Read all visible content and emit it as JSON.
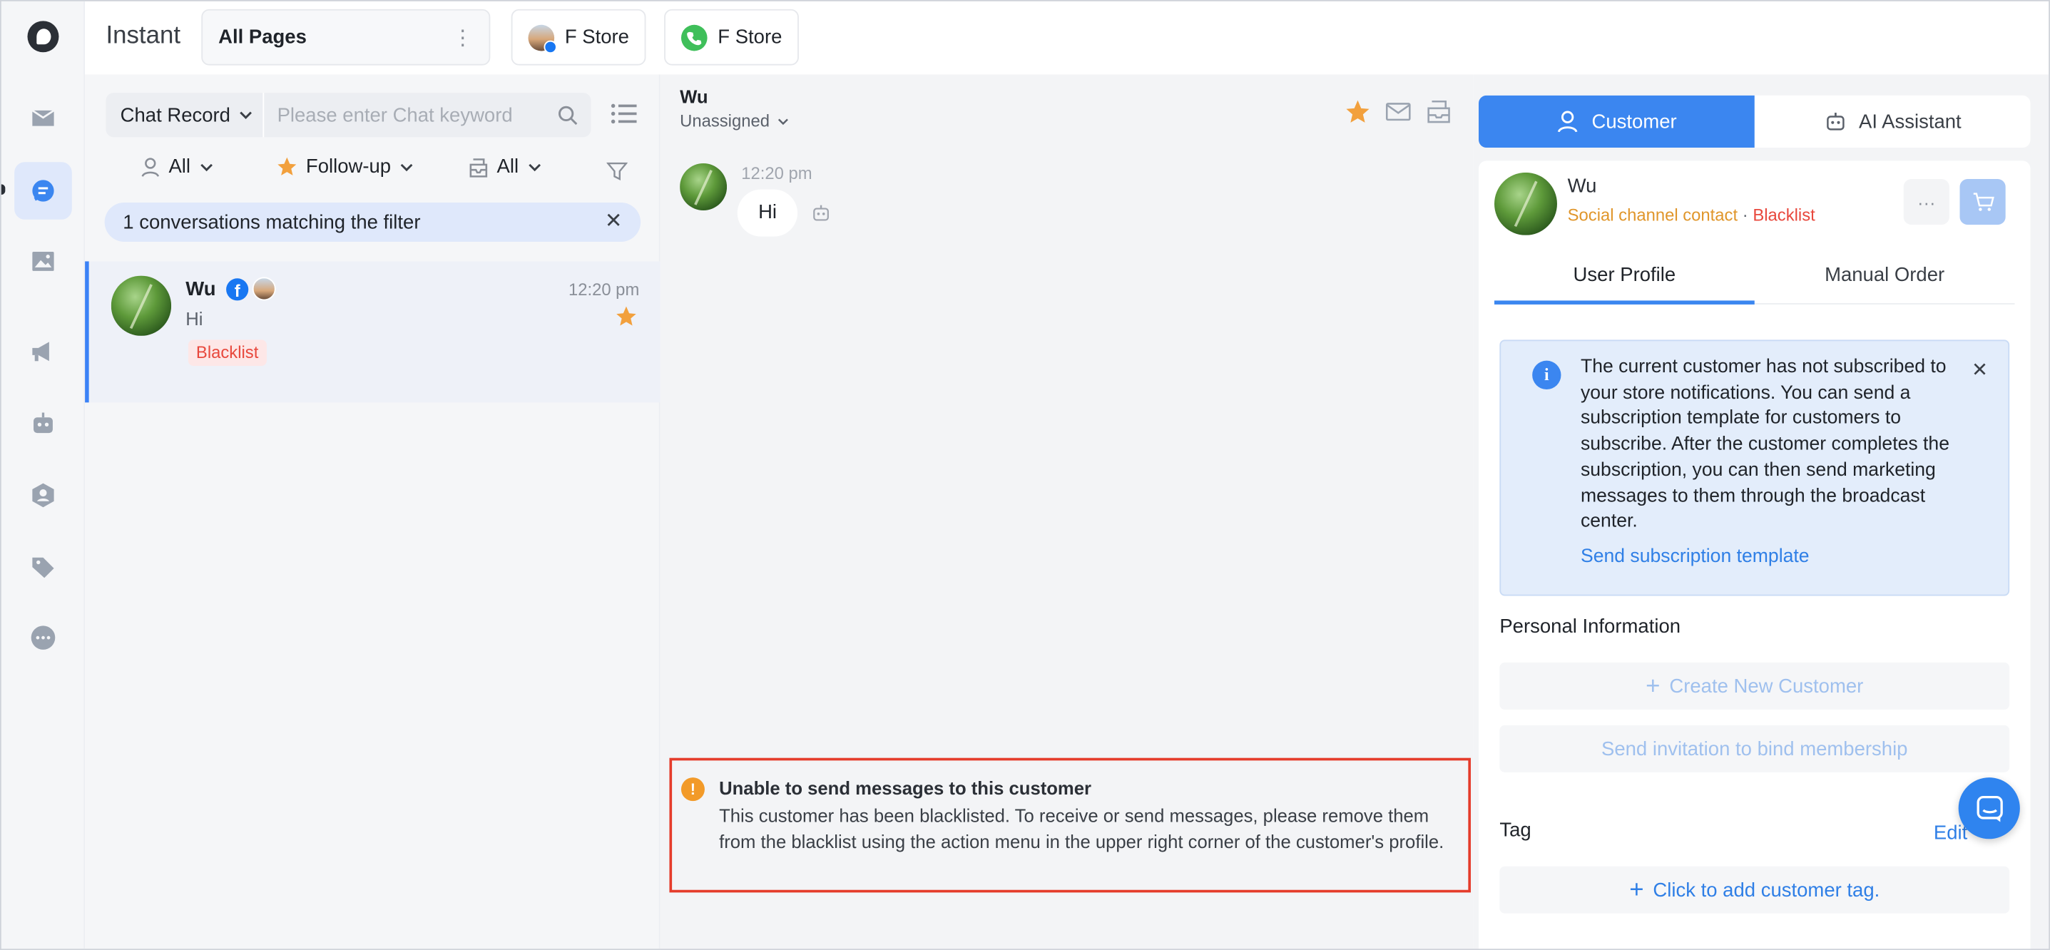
{
  "app": {
    "brand": "Instant",
    "page_selector": "All Pages"
  },
  "stores": [
    {
      "label": "F Store",
      "channel": "facebook"
    },
    {
      "label": "F Store",
      "channel": "whatsapp"
    }
  ],
  "sidebar": {
    "items": [
      {
        "name": "inbox-icon"
      },
      {
        "name": "chat-icon",
        "active": true
      },
      {
        "name": "image-icon"
      },
      {
        "name": "megaphone-icon"
      },
      {
        "name": "robot-icon"
      },
      {
        "name": "contacts-icon"
      },
      {
        "name": "tag-icon"
      },
      {
        "name": "more-icon"
      }
    ]
  },
  "conversation_list": {
    "search_type": "Chat Record",
    "search_placeholder": "Please enter Chat keyword",
    "filters": {
      "assignee": "All",
      "followup": "Follow-up",
      "inbox": "All"
    },
    "match_text": "1 conversations matching the filter",
    "items": [
      {
        "name": "Wu",
        "time": "12:20 pm",
        "last_message": "Hi",
        "tag": "Blacklist",
        "starred": true
      }
    ]
  },
  "chat": {
    "contact_name": "Wu",
    "assignment": "Unassigned",
    "messages": [
      {
        "time": "12:20 pm",
        "text": "Hi"
      }
    ],
    "warning": {
      "title": "Unable to send messages to this customer",
      "body": "This customer has been blacklisted. To receive or send messages, please remove them from the blacklist using the action menu in the upper right corner of the customer's profile."
    }
  },
  "customer_panel": {
    "tabs": {
      "customer": "Customer",
      "ai": "AI Assistant"
    },
    "name": "Wu",
    "contact_type": "Social channel contact",
    "separator": "·",
    "status": "Blacklist",
    "sub_tabs": {
      "profile": "User Profile",
      "order": "Manual Order"
    },
    "notice": {
      "text": "The current customer has not subscribed to your store notifications. You can send a subscription template for customers to subscribe. After the customer completes the subscription, you can then send marketing messages to them through the broadcast center.",
      "link": "Send subscription template"
    },
    "personal_info_title": "Personal Information",
    "create_customer": "Create New Customer",
    "bind_membership": "Send invitation to bind membership",
    "tag_title": "Tag",
    "edit_label": "Edit",
    "add_tag": "Click to add customer tag."
  },
  "colors": {
    "accent": "#3b86f0",
    "warning": "#f29a29",
    "danger": "#e8483d",
    "star": "#f2a03d"
  }
}
